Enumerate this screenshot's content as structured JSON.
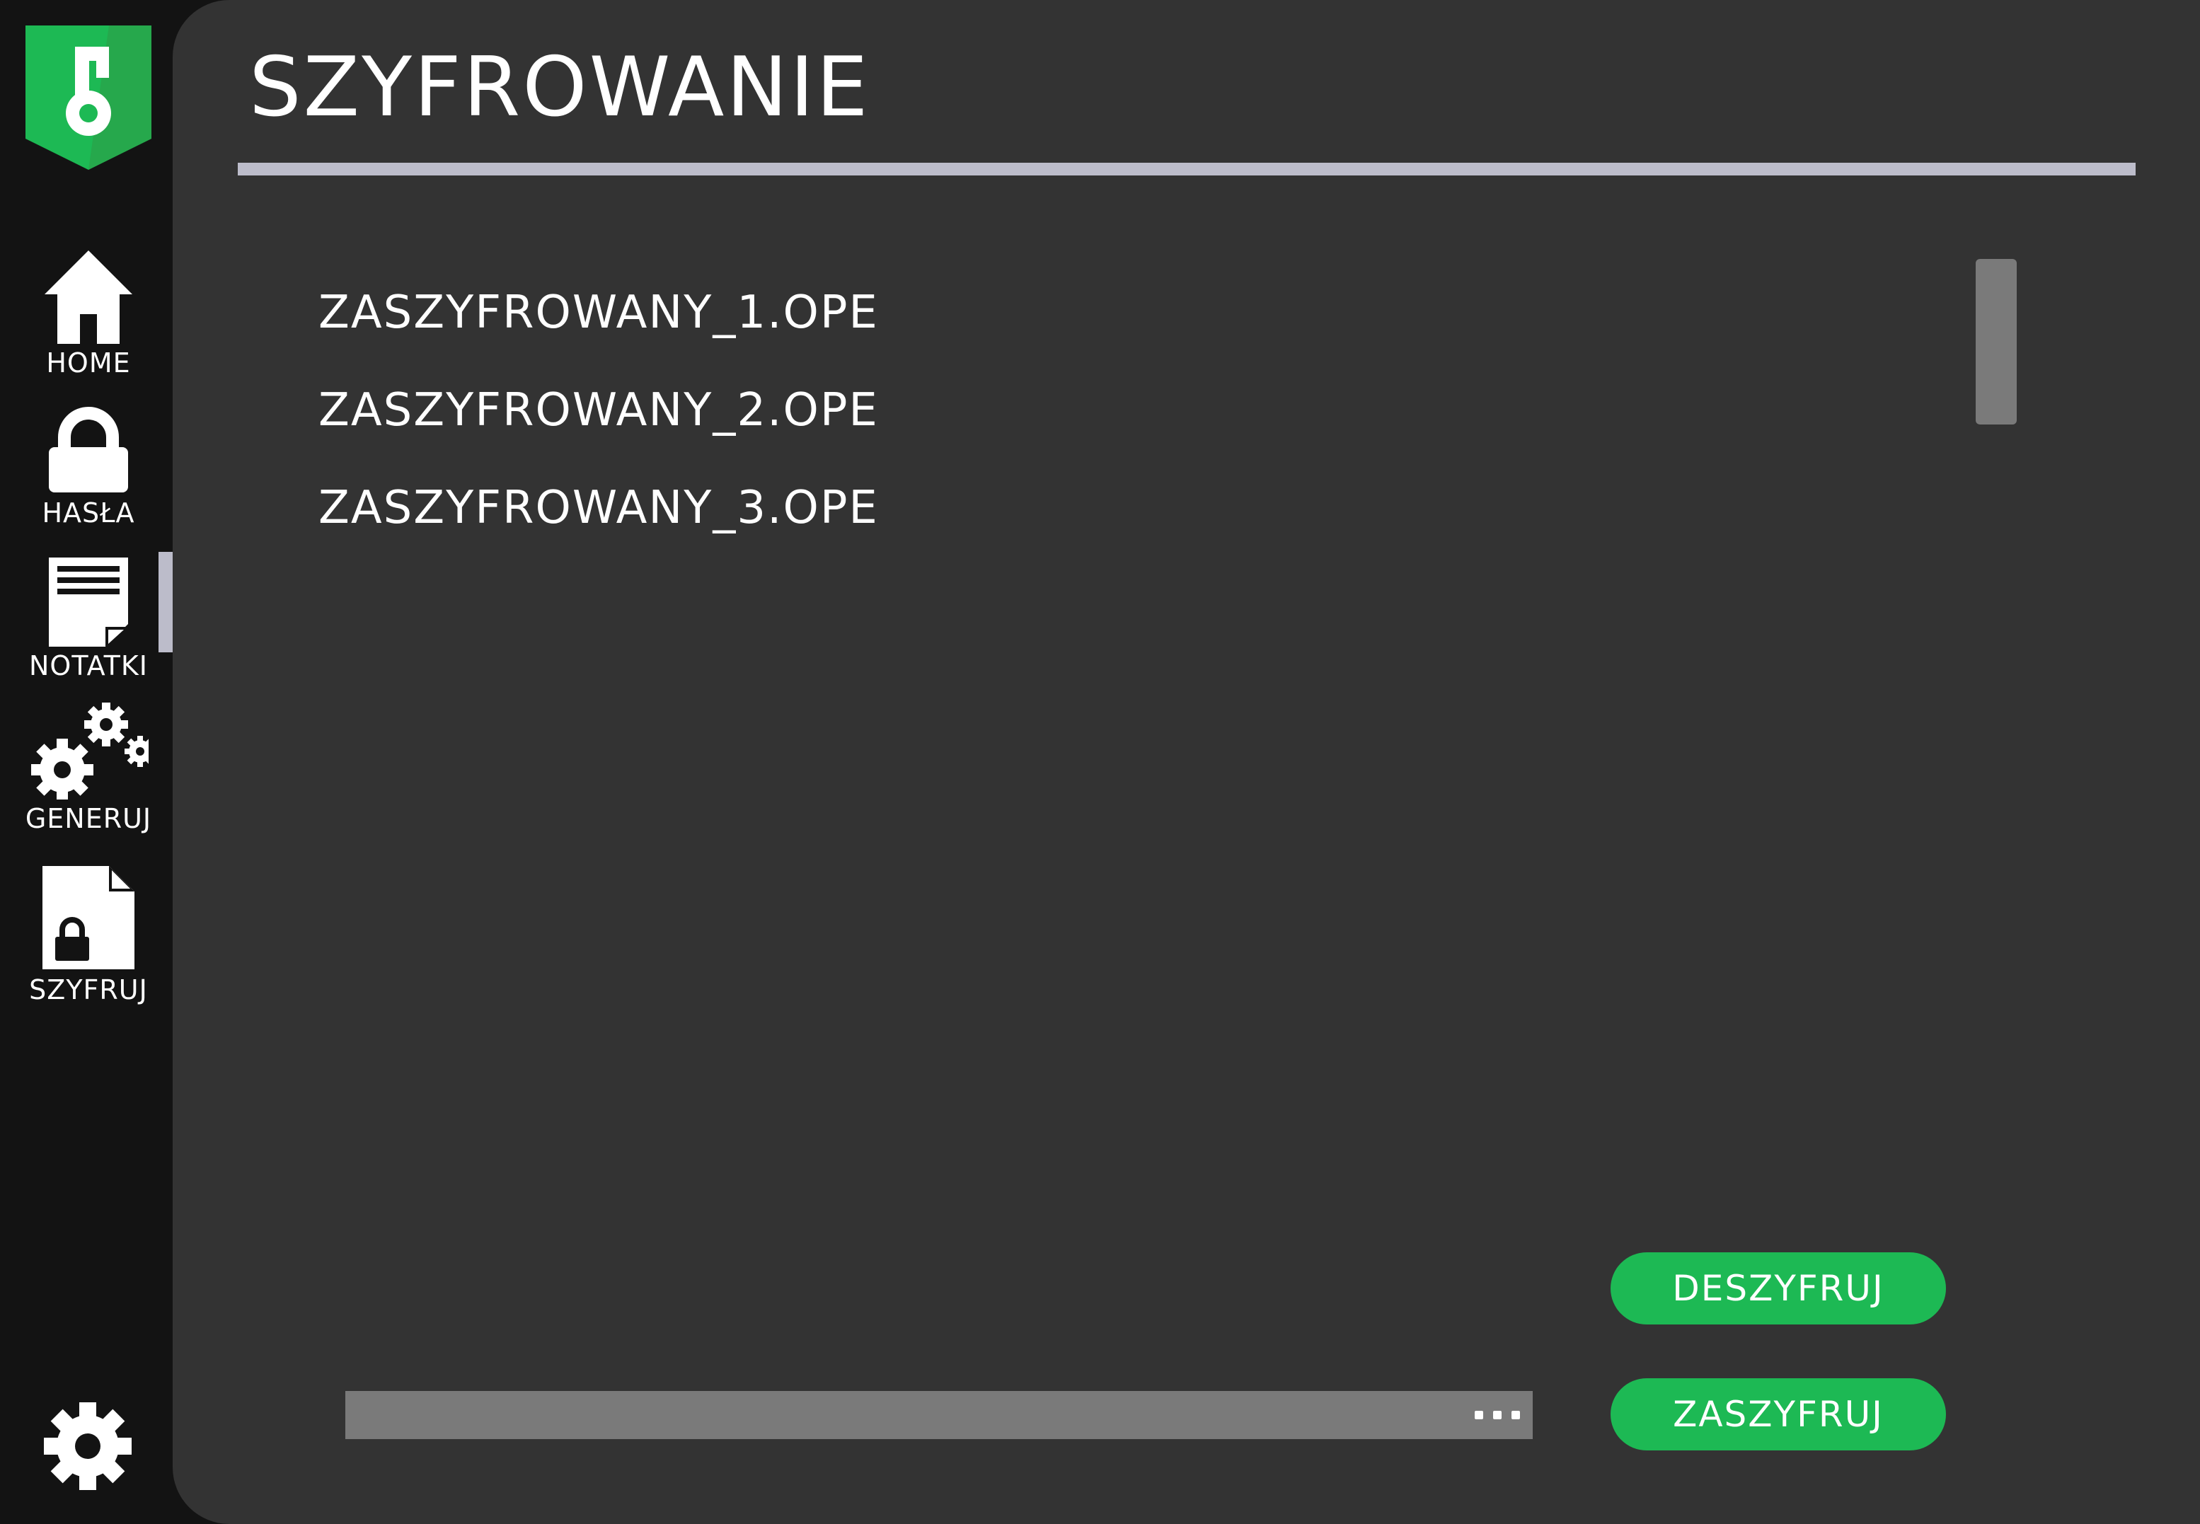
{
  "app": {
    "accent_color": "#1db954",
    "logo_icon": "key-shield-icon"
  },
  "sidebar": {
    "items": [
      {
        "label": "HOME",
        "icon": "home-icon"
      },
      {
        "label": "HASŁA",
        "icon": "lock-icon"
      },
      {
        "label": "NOTATKI",
        "icon": "note-icon"
      },
      {
        "label": "GENERUJ",
        "icon": "gears-icon"
      },
      {
        "label": "SZYFRUJ",
        "icon": "locked-file-icon"
      }
    ],
    "active_item": "NOTATKI",
    "settings_icon": "gear-icon"
  },
  "main": {
    "title": "SZYFROWANIE",
    "files": [
      "ZASZYFROWANY_1.OPE",
      "ZASZYFROWANY_2.OPE",
      "ZASZYFROWANY_3.OPE"
    ],
    "buttons": {
      "decrypt_label": "DESZYFRUJ",
      "encrypt_label": "ZASZYFRUJ"
    },
    "path_field": {
      "value": "",
      "browse_icon": "ellipsis-icon"
    }
  }
}
